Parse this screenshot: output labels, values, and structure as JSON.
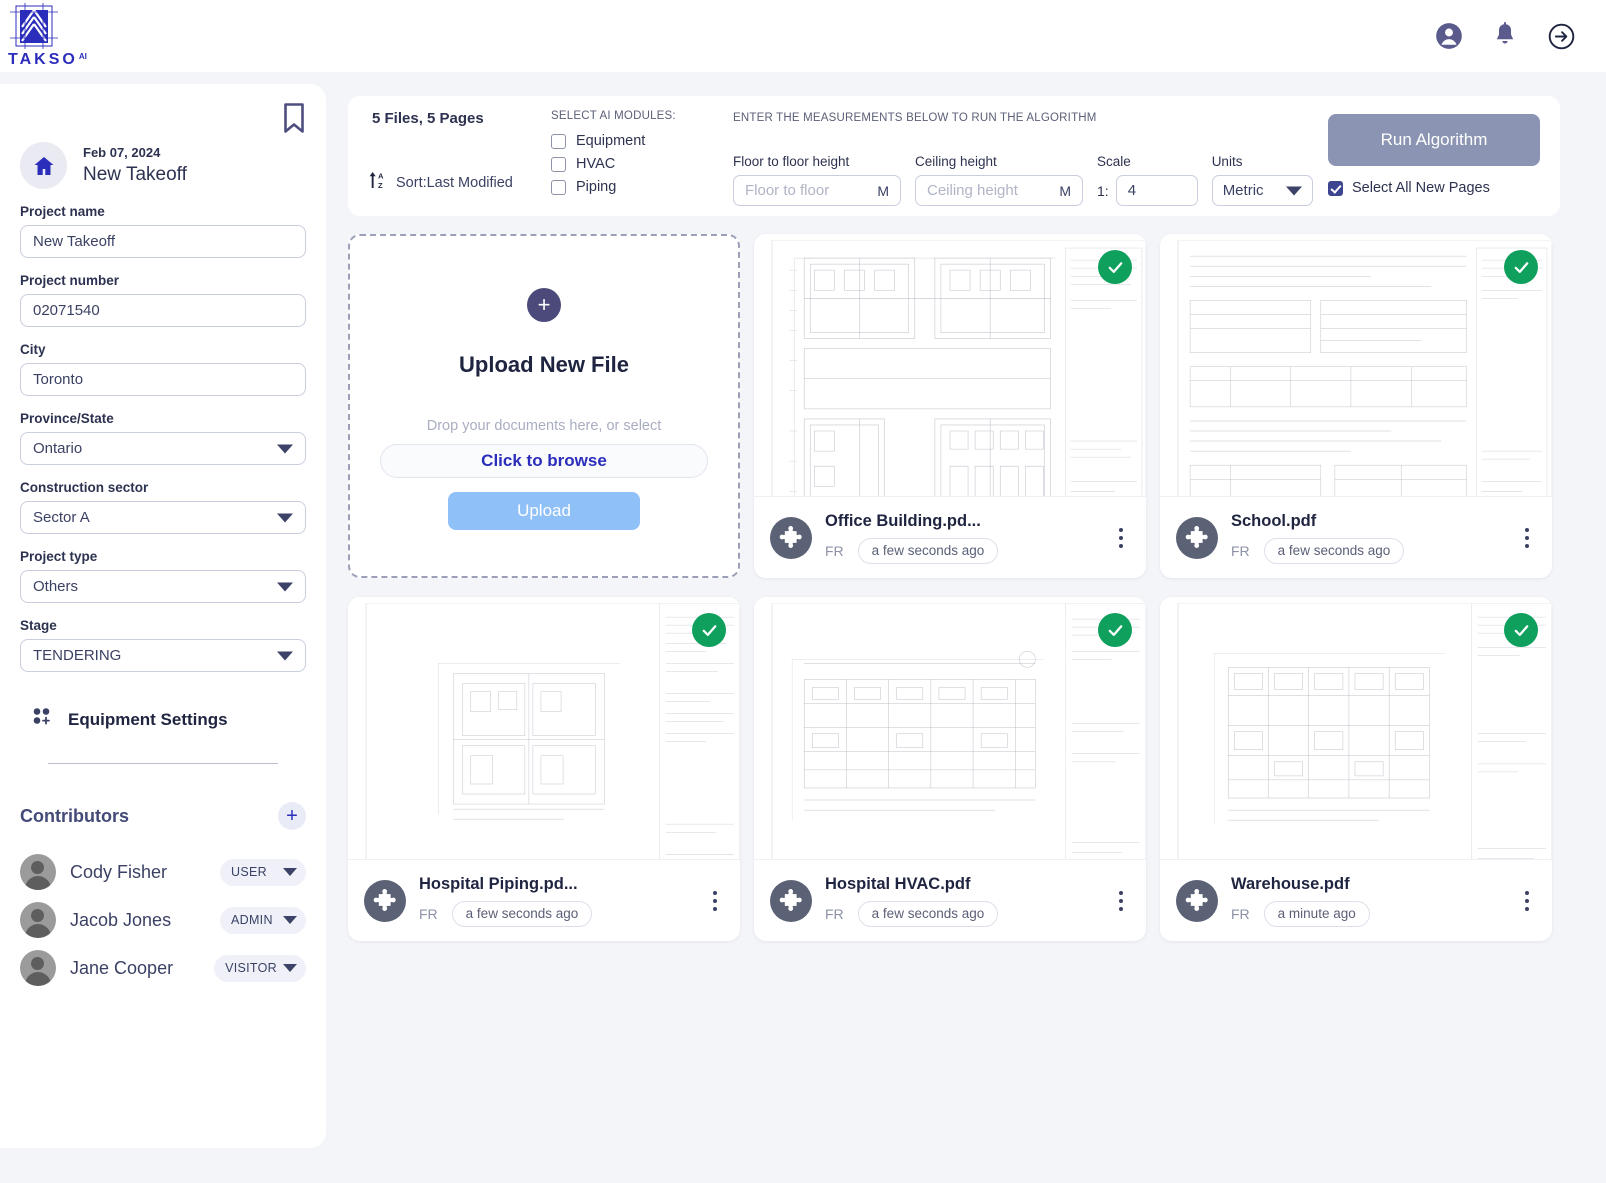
{
  "app": {
    "brand_name": "TAKSO",
    "brand_sup": "AI"
  },
  "header": {
    "icons": [
      {
        "name": "account-icon",
        "label": "Account"
      },
      {
        "name": "notification-bell-icon",
        "label": "Notifications"
      },
      {
        "name": "logout-arrow-icon",
        "label": "Logout"
      }
    ]
  },
  "sidebar": {
    "bookmark_icon": "bookmark-icon",
    "project_date": "Feb 07, 2024",
    "project_title": "New Takeoff",
    "fields": [
      {
        "label": "Project name",
        "value": "New Takeoff",
        "type": "text"
      },
      {
        "label": "Project number",
        "value": "02071540",
        "type": "text"
      },
      {
        "label": "City",
        "value": "Toronto",
        "type": "text"
      },
      {
        "label": "Province/State",
        "value": "Ontario",
        "type": "select"
      },
      {
        "label": "Construction sector",
        "value": "Sector A",
        "type": "select"
      },
      {
        "label": "Project type",
        "value": "Others",
        "type": "select"
      },
      {
        "label": "Stage",
        "value": "TENDERING",
        "type": "select"
      }
    ],
    "equipment_settings_label": "Equipment Settings",
    "contributors_title": "Contributors",
    "add_contributor_label": "+",
    "contributors": [
      {
        "name": "Cody Fisher",
        "role": "USER"
      },
      {
        "name": "Jacob Jones",
        "role": "ADMIN"
      },
      {
        "name": "Jane Cooper",
        "role": "VISITOR"
      }
    ]
  },
  "toolbar": {
    "files_count_text": "5 Files,  5 Pages",
    "sort_label": "Sort:Last Modified",
    "modules_caption": "SELECT AI MODULES:",
    "modules": [
      {
        "label": "Equipment",
        "checked": false
      },
      {
        "label": "HVAC",
        "checked": false
      },
      {
        "label": "Piping",
        "checked": false
      }
    ],
    "measurements_caption": "ENTER THE MEASUREMENTS BELOW TO RUN THE ALGORITHM",
    "floor_to_floor": {
      "label": "Floor to floor height",
      "placeholder": "Floor to floor",
      "value": "",
      "unit": "M"
    },
    "ceiling_height": {
      "label": "Ceiling height",
      "placeholder": "Ceiling height",
      "value": "",
      "unit": "M"
    },
    "scale": {
      "label": "Scale",
      "prefix": "1:",
      "value": "4"
    },
    "units": {
      "label": "Units",
      "value": "Metric"
    },
    "run_button_label": "Run Algorithm",
    "select_all_label": "Select All New Pages",
    "select_all_checked": true
  },
  "upload_card": {
    "plus_label": "+",
    "title": "Upload New File",
    "hint": "Drop your documents here, or select",
    "browse_label": "Click to browse",
    "upload_label": "Upload"
  },
  "files": [
    {
      "name": "Office Building.pd...",
      "lang": "FR",
      "time": "a few seconds ago",
      "selected": true
    },
    {
      "name": "School.pdf",
      "lang": "FR",
      "time": "a few seconds ago",
      "selected": true
    },
    {
      "name": "Hospital Piping.pd...",
      "lang": "FR",
      "time": "a few seconds ago",
      "selected": true
    },
    {
      "name": "Hospital HVAC.pdf",
      "lang": "FR",
      "time": "a few seconds ago",
      "selected": true
    },
    {
      "name": "Warehouse.pdf",
      "lang": "FR",
      "time": "a minute ago",
      "selected": true
    }
  ],
  "colors": {
    "brand": "#2b2dbb",
    "accent_purple": "#4b4a7a",
    "check_green": "#10a05e",
    "run_button": "#8b95b3",
    "upload_button": "#8fc0f7",
    "page_bg": "#f4f5f9"
  }
}
